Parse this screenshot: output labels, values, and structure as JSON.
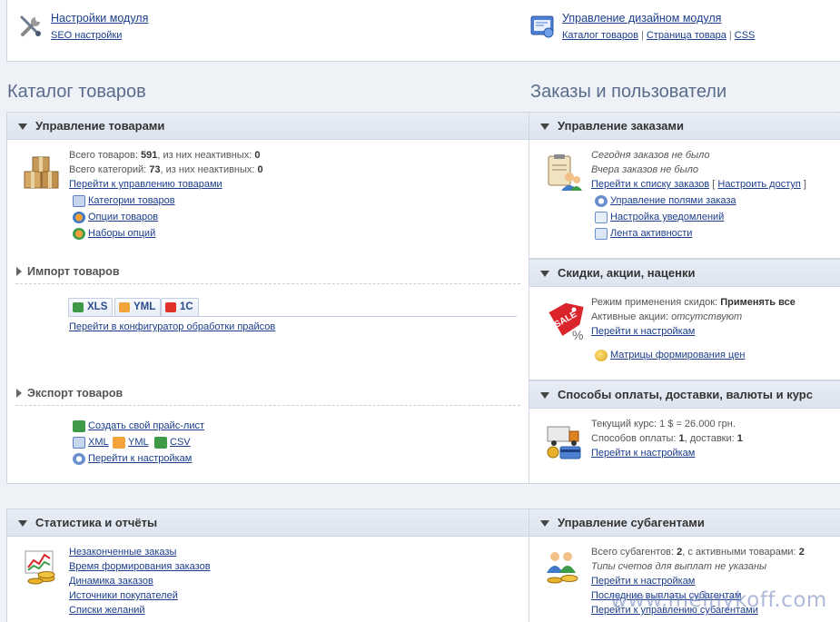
{
  "top": {
    "module_settings": "Настройки модуля",
    "seo_settings": "SEO настройки",
    "design": "Управление дизайном модуля",
    "design_links": [
      "Каталог товаров",
      "Страница товара",
      "CSS"
    ]
  },
  "left_title": "Каталог товаров",
  "right_title": "Заказы и пользователи",
  "products": {
    "header": "Управление товарами",
    "total_label": "Всего товаров: ",
    "total": "591",
    "inactive_label": ", из них неактивных: ",
    "inactive": "0",
    "cats_label": "Всего категорий: ",
    "cats": "73",
    "cats_inactive_label": ", из них неактивных: ",
    "cats_inactive": "0",
    "goto": "Перейти к управлению товарами",
    "links": [
      "Категории товаров",
      "Опции товаров",
      "Наборы опций"
    ]
  },
  "import": {
    "header": "Импорт товаров",
    "tabs": [
      "XLS",
      "YML",
      "1C"
    ],
    "link": "Перейти в конфигуратор обработки прайсов"
  },
  "export": {
    "header": "Экспорт товаров",
    "create": "Создать свой прайс-лист",
    "formats": [
      "XML",
      "YML",
      "CSV"
    ],
    "settings": "Перейти к настройкам"
  },
  "orders": {
    "header": "Управление заказами",
    "today": "Сегодня заказов не было",
    "yesterday": "Вчера заказов не было",
    "goto_list": "Перейти к списку заказов",
    "configure": "Настроить доступ",
    "links": [
      "Управление полями заказа",
      "Настройка уведомлений",
      "Лента активности"
    ]
  },
  "discounts": {
    "header": "Скидки, акции, наценки",
    "mode_label": "Режим применения скидок: ",
    "mode": "Применять все",
    "active_label": "Активные акции: ",
    "active": "отсутствуют",
    "settings": "Перейти к настройкам",
    "matrix": "Матрицы формирования цен",
    "sale_badge": "SALE"
  },
  "payment": {
    "header": "Способы оплаты, доставки, валюты и курс",
    "rate_label": "Текущий курс: ",
    "rate": "1 $ = 26.000 грн.",
    "methods_label": "Способов оплаты: ",
    "methods": "1",
    "delivery_label": ", доставки: ",
    "delivery": "1",
    "settings": "Перейти к настройкам"
  },
  "stats": {
    "header": "Статистика и отчёты",
    "links": [
      "Незаконченные заказы",
      "Время формирования заказов",
      "Динамика заказов",
      "Источники покупателей",
      "Списки желаний"
    ]
  },
  "subagents": {
    "header": "Управление субагентами",
    "total_label": "Всего субагентов: ",
    "total": "2",
    "active_label": ", с активными товарами: ",
    "active": "2",
    "types": "Типы счетов для выплат не указаны",
    "settings": "Перейти к настройкам",
    "last": "Последние выплаты субагентам",
    "manage": "Перейти к управлению субагентами"
  },
  "watermark": "www.melnykoff.com"
}
